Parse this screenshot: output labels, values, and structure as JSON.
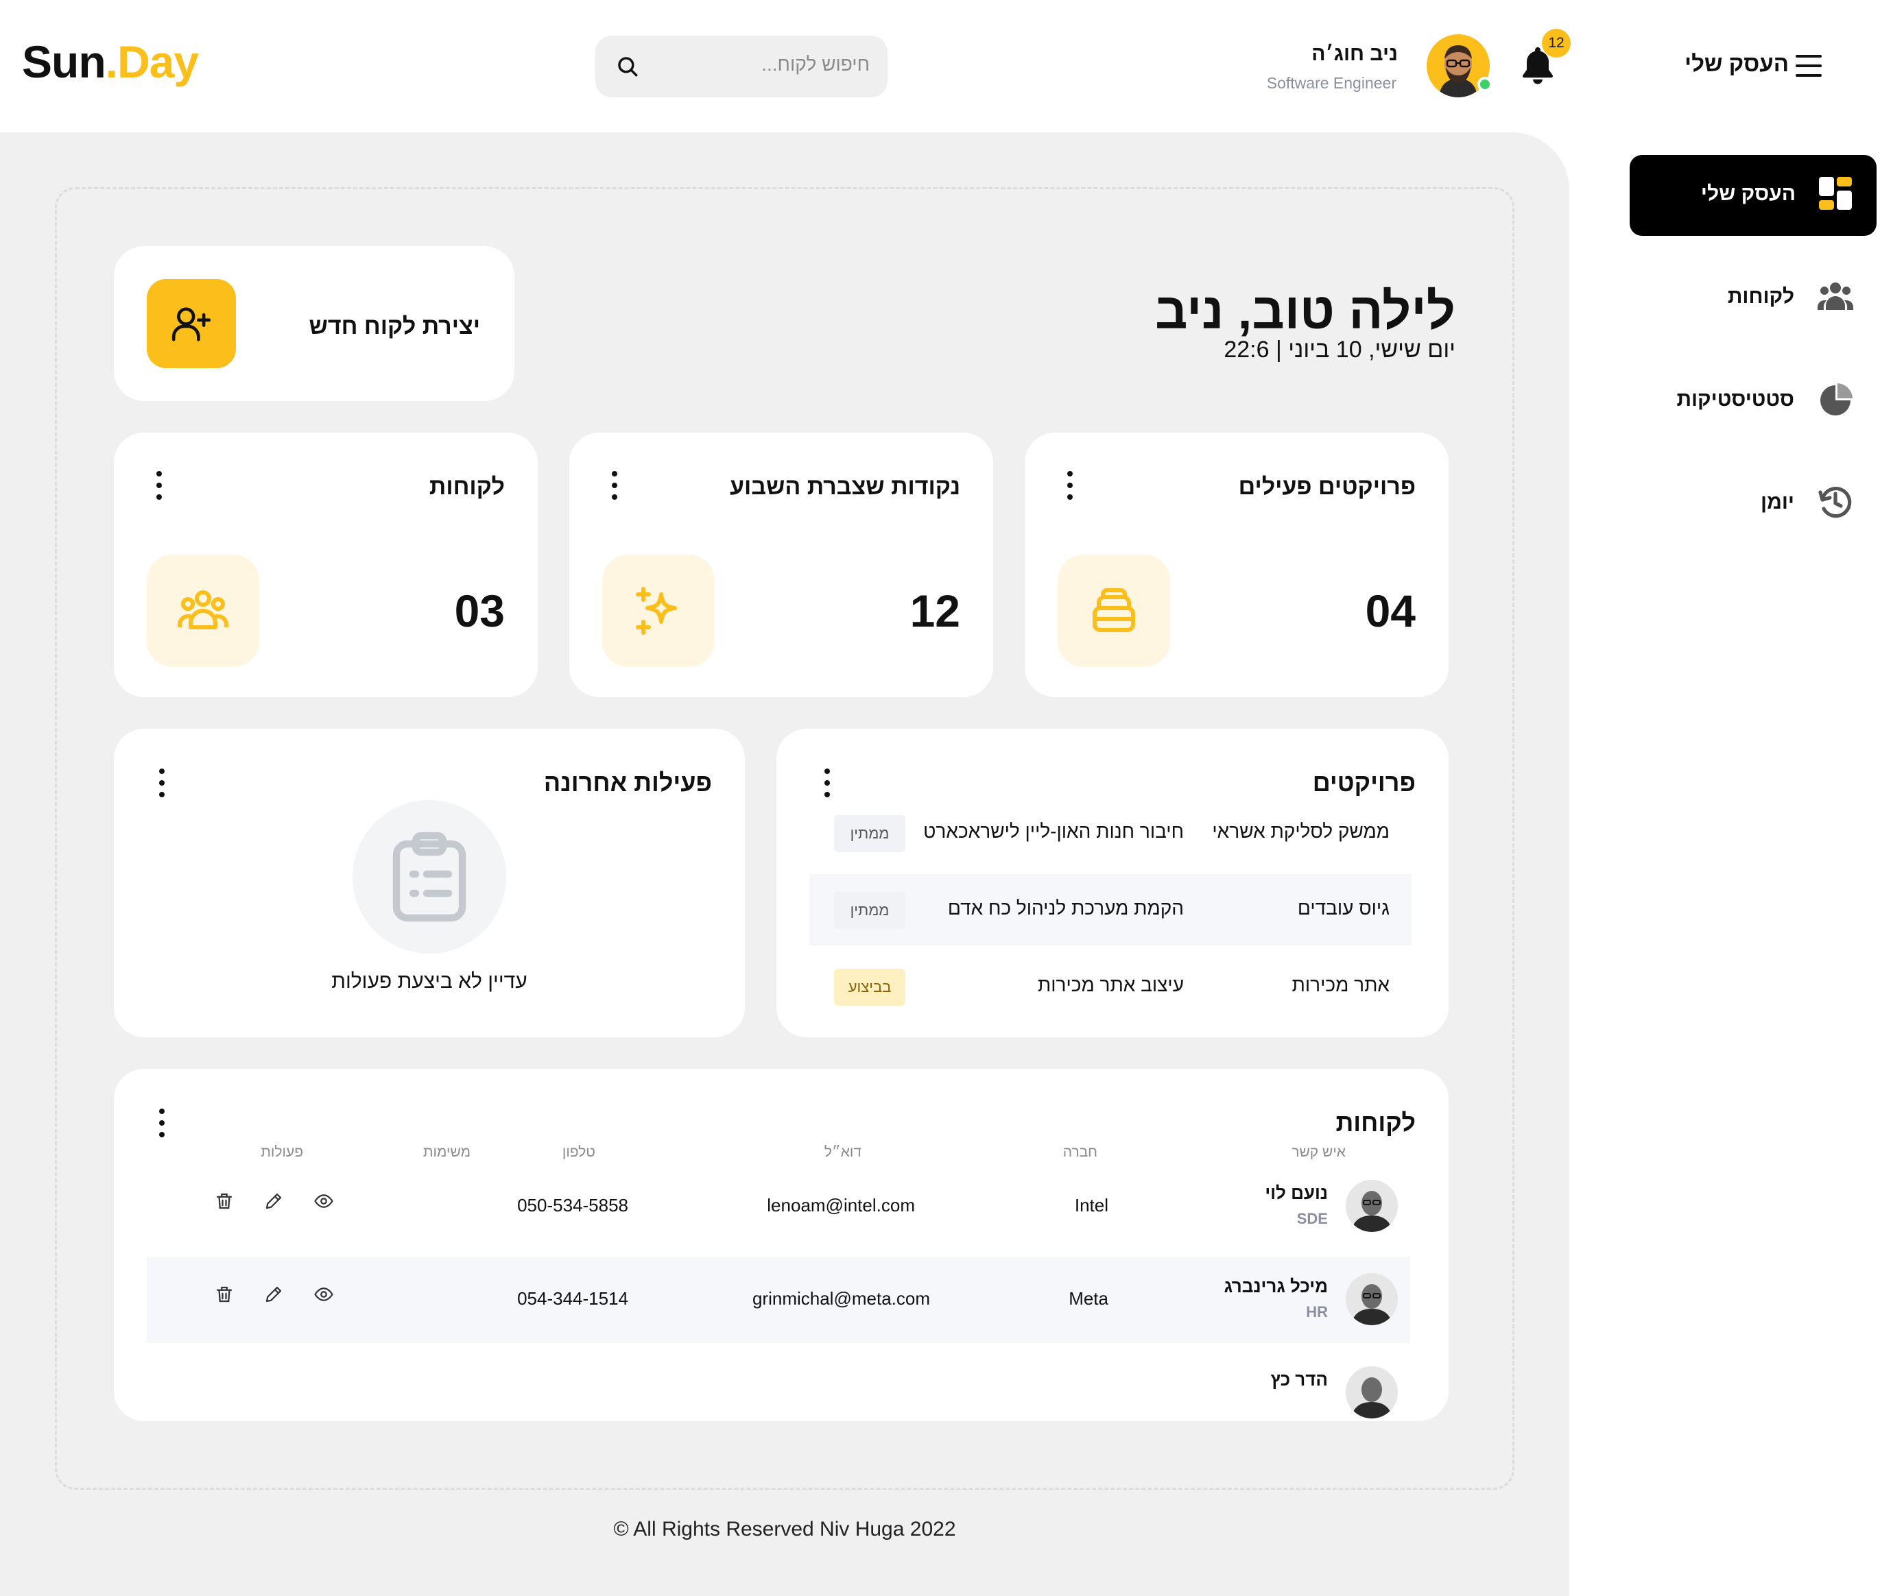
{
  "header": {
    "logo_sun": "Sun",
    "logo_dot": ".",
    "logo_day": "Day",
    "search_placeholder": "חיפוש לקוח...",
    "user_name": "ניב חוג׳ה",
    "user_role": "Software Engineer",
    "notifications_count": "12",
    "menu_title": "העסק שלי"
  },
  "sidebar": {
    "items": [
      {
        "label": "העסק שלי",
        "icon": "dashboard-icon",
        "active": true
      },
      {
        "label": "לקוחות",
        "icon": "users-icon",
        "active": false
      },
      {
        "label": "סטטיסטיקות",
        "icon": "pie-chart-icon",
        "active": false
      },
      {
        "label": "יומן",
        "icon": "history-icon",
        "active": false
      }
    ]
  },
  "greeting": {
    "title": "לילה טוב, ניב",
    "date": "יום שישי, 10 ביוני | 22:6"
  },
  "new_client": {
    "label": "יצירת לקוח חדש",
    "icon": "user-plus-icon"
  },
  "stats": [
    {
      "title": "פרויקטים פעילים",
      "value": "04",
      "icon": "stack-icon"
    },
    {
      "title": "נקודות שצברת השבוע",
      "value": "12",
      "icon": "sparkles-icon"
    },
    {
      "title": "לקוחות",
      "value": "03",
      "icon": "group-icon"
    }
  ],
  "projects": {
    "title": "פרויקטים",
    "rows": [
      {
        "client": "ממשק לסליקת אשראי",
        "name": "חיבור חנות האון-ליין לישראכארט",
        "status": "ממתין",
        "status_kind": "wait"
      },
      {
        "client": "גיוס עובדים",
        "name": "הקמת מערכת לניהול כח אדם",
        "status": "ממתין",
        "status_kind": "wait"
      },
      {
        "client": "אתר מכירות",
        "name": "עיצוב אתר מכירות",
        "status": "בביצוע",
        "status_kind": "progress"
      }
    ]
  },
  "activity": {
    "title": "פעילות אחרונה",
    "empty_text": "עדיין לא ביצעת פעולות"
  },
  "clients": {
    "title": "לקוחות",
    "columns": [
      "איש קשר",
      "חברה",
      "דוא״ל",
      "טלפון",
      "משימות",
      "פעולות"
    ],
    "rows": [
      {
        "name": "נועם לוי",
        "role": "SDE",
        "company": "Intel",
        "email": "lenoam@intel.com",
        "phone": "050-534-5858"
      },
      {
        "name": "מיכל גרינברג",
        "role": "HR",
        "company": "Meta",
        "email": "grinmichal@meta.com",
        "phone": "054-344-1514"
      },
      {
        "name": "הדר כץ",
        "role": "",
        "company": "",
        "email": "",
        "phone": ""
      }
    ]
  },
  "footer": "© All Rights Reserved Niv Huga 2022",
  "colors": {
    "accent": "#fbbe1a",
    "accent_soft": "#fff6e2",
    "dark": "#000000",
    "bg": "#f0f0f0"
  }
}
